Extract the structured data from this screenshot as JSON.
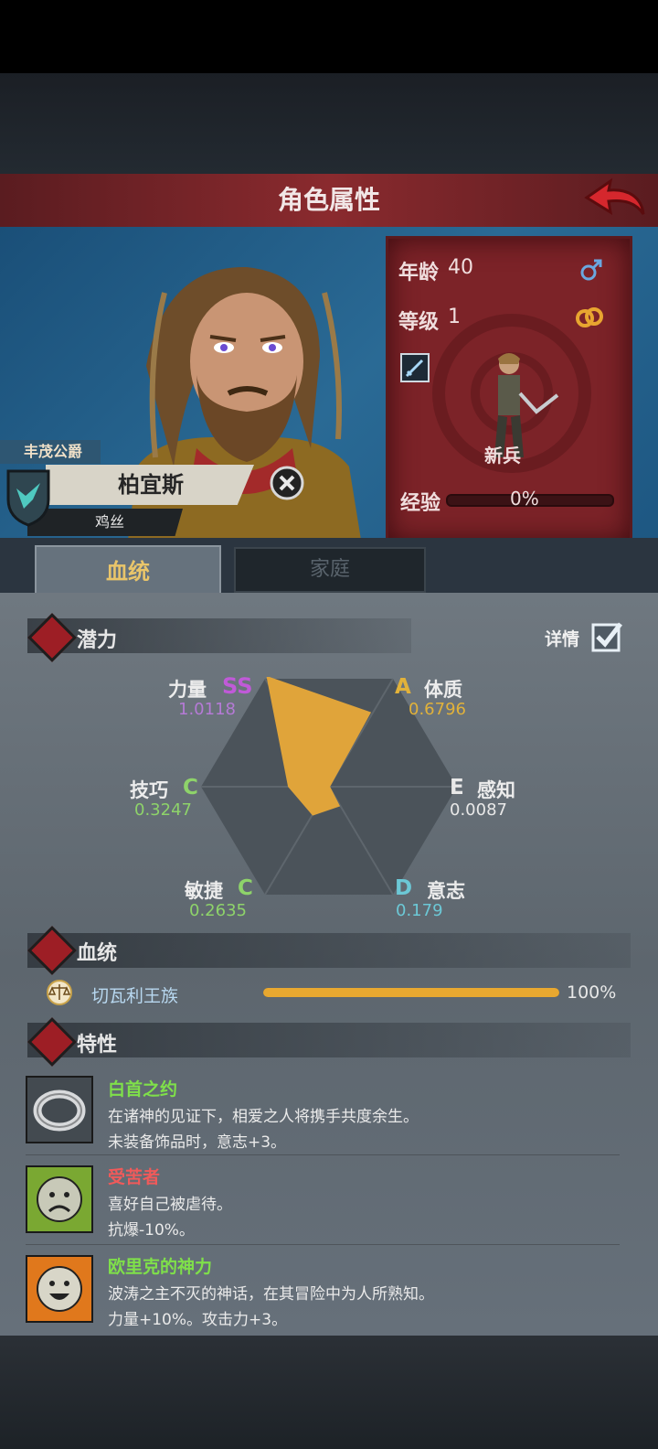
{
  "header": {
    "title": "角色属性"
  },
  "character": {
    "title_tag": "丰茂公爵",
    "name": "柏宜斯",
    "subtitle": "鸡丝",
    "age_label": "年龄",
    "age": "40",
    "level_label": "等级",
    "level": "1",
    "class_name": "新兵",
    "exp_label": "经验",
    "exp_value": "0%",
    "exp_fraction": 0
  },
  "tabs": [
    {
      "label": "血统",
      "active": true
    },
    {
      "label": "家庭",
      "active": false
    }
  ],
  "potential": {
    "title": "潜力",
    "detail_label": "详情",
    "detail_checked": true,
    "stats": [
      {
        "name": "力量",
        "grade": "SS",
        "value": "1.0118",
        "grade_color": "#c05ad8",
        "value_color": "#b57ad6"
      },
      {
        "name": "体质",
        "grade": "A",
        "value": "0.6796",
        "grade_color": "#e2b23a",
        "value_color": "#e2b23a"
      },
      {
        "name": "感知",
        "grade": "E",
        "value": "0.0087",
        "grade_color": "#e8e8e8",
        "value_color": "#e8e8e8"
      },
      {
        "name": "意志",
        "grade": "D",
        "value": "0.179",
        "grade_color": "#6cc8d6",
        "value_color": "#6cc8d6"
      },
      {
        "name": "敏捷",
        "grade": "C",
        "value": "0.2635",
        "grade_color": "#8ed36a",
        "value_color": "#8ed36a"
      },
      {
        "name": "技巧",
        "grade": "C",
        "value": "0.3247",
        "grade_color": "#8ed36a",
        "value_color": "#8ed36a"
      }
    ],
    "radar_fill": "#e0a43a"
  },
  "bloodline": {
    "title": "血统",
    "name": "切瓦利王族",
    "percent_label": "100%",
    "fraction": 1.0,
    "name_color": "#b8d8f0",
    "bar_color": "#e8a830"
  },
  "traits": {
    "title": "特性",
    "items": [
      {
        "name": "白首之约",
        "color": "#7fe04a",
        "desc": "在诸神的见证下，相爱之人将携手共度余生。",
        "effect": "未装备饰品时，意志+3。",
        "icon": "ring-icon"
      },
      {
        "name": "受苦者",
        "color": "#f05a5a",
        "desc": "喜好自己被虐待。",
        "effect": "抗爆-10%。",
        "icon": "sad-face-icon"
      },
      {
        "name": "欧里克的神力",
        "color": "#7fe04a",
        "desc": "波涛之主不灭的神话，在其冒险中为人所熟知。",
        "effect": "力量+10%。攻击力+3。",
        "icon": "happy-face-icon"
      }
    ]
  }
}
